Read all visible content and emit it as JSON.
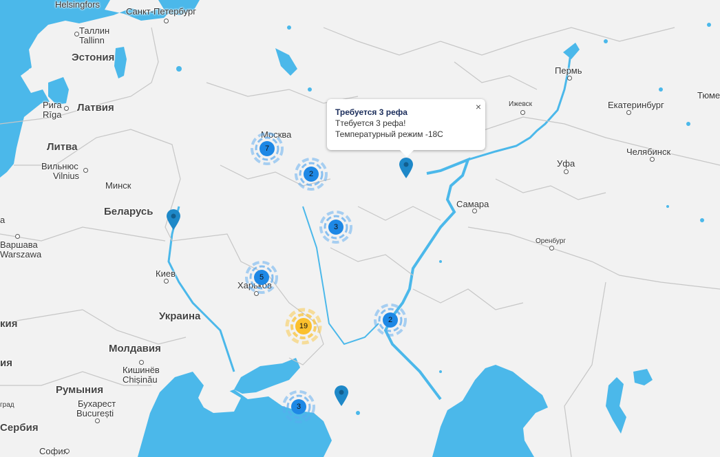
{
  "colors": {
    "water": "#4bb8ea",
    "land": "#f2f2f2",
    "border": "#c6c6c6",
    "cluster_blue": "#1e88e5",
    "cluster_blue_ring": "#5aaaf0",
    "cluster_yellow": "#fbc02d",
    "pin": "#1e88c8"
  },
  "labels": {
    "helsingfors": "Helsingfors",
    "spb": "Санкт-Петербург",
    "tallinn_ru": "Таллин",
    "tallinn": "Tallinn",
    "estonia": "Эстония",
    "riga_ru": "Рига",
    "riga": "Rīga",
    "latvia": "Латвия",
    "lithuania": "Литва",
    "vilnius_ru": "Вильнюс",
    "vilnius": "Vilnius",
    "minsk": "Минск",
    "belarus": "Беларусь",
    "warsaw_ru": "Варшава",
    "warsaw": "Warszawa",
    "kyiv": "Киев",
    "ukraine": "Украина",
    "kharkiv": "Харьков",
    "moscow": "Москва",
    "moldova": "Молдавия",
    "chisinau_ru": "Кишинёв",
    "chisinau": "Chișinău",
    "romania": "Румыния",
    "bucharest_ru": "Бухарест",
    "bucharest": "București",
    "serbia": "Сербия",
    "sofia": "София",
    "grad": "град",
    "perm": "Пермь",
    "izhevsk": "Ижевск",
    "yekaterinburg": "Екатеринбург",
    "tyumen": "Тюме",
    "chelyabinsk": "Челябинск",
    "ufa": "Уфа",
    "samara": "Самара",
    "orenburg": "Оренбург",
    "edge_a": "а",
    "edge_kia": "кия",
    "edge_ia": "ия"
  },
  "clusters": [
    {
      "count": "7",
      "type": "blue"
    },
    {
      "count": "2",
      "type": "blue"
    },
    {
      "count": "3",
      "type": "blue"
    },
    {
      "count": "5",
      "type": "blue"
    },
    {
      "count": "19",
      "type": "yellow"
    },
    {
      "count": "2",
      "type": "blue"
    },
    {
      "count": "3",
      "type": "blue"
    }
  ],
  "popup": {
    "title": "Требуется 3 рефа",
    "line1": "Ттебуется 3 рефа!",
    "line2": "Температурный режим -18С",
    "close": "×"
  }
}
